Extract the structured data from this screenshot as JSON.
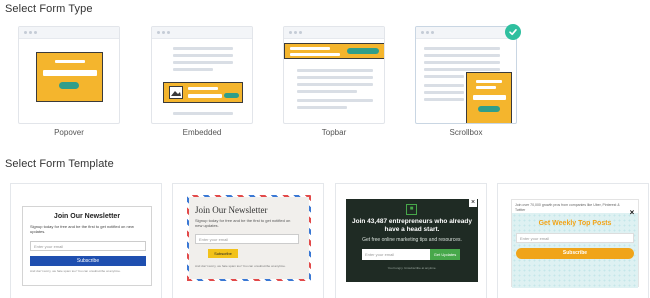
{
  "form_type": {
    "title": "Select Form Type",
    "options": [
      {
        "label": "Popover"
      },
      {
        "label": "Embedded"
      },
      {
        "label": "Topbar"
      },
      {
        "label": "Scrollbox",
        "selected": true
      }
    ]
  },
  "form_template": {
    "title": "Select Form Template",
    "templates": [
      {
        "heading": "Join Our Newsletter",
        "body": "Signup today for free and be the first to get notified on new updates.",
        "placeholder": "Enter your email",
        "button": "Subscribe",
        "fineprint": "And don't worry, we hate spam too! You can unsubscribe at anytime."
      },
      {
        "heading": "Join Our Newsletter",
        "body": "Signup today for free and be the first to get notified on new updates.",
        "placeholder": "Enter your email",
        "button": "Subscribe",
        "fineprint": "And don't worry, we hate spam too! You can unsubscribe at anytime."
      },
      {
        "heading": "Join 43,487 entrepreneurs who already have a head start.",
        "subtitle": "Get free online marketing tips and resources.",
        "placeholder": "Enter your email",
        "button": "Get Updates",
        "fineprint": "You hungry. Unsubscribe at anytime."
      },
      {
        "topline": "Join over 70,000 growth pros from companies like Uber, Pinterest & Twitter",
        "heading": "Get Weekly Top Posts",
        "placeholder": "Enter your email",
        "button": "Subscribe"
      }
    ]
  },
  "colors": {
    "accent_orange": "#f4b52d",
    "teal_pill": "#2f9e8a",
    "check_green": "#2fbf9f",
    "subscribe_blue": "#1f4fb0",
    "dark_green_bg": "#1f2b24",
    "get_updates_green": "#47a84a"
  },
  "icons": {
    "selected_check": "check-circle-icon",
    "close": "close-icon",
    "image_placeholder": "image-icon",
    "logo_badge": "badge-icon"
  }
}
